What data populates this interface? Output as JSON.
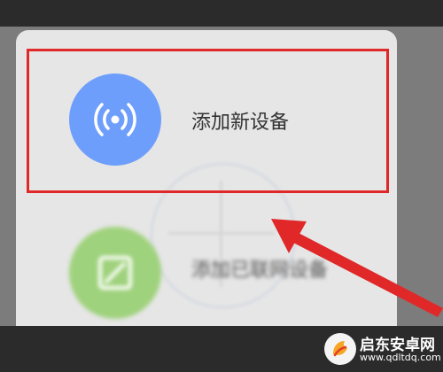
{
  "menu": {
    "items": [
      {
        "label": "添加新设备",
        "icon": "signal-broadcast-icon",
        "color": "#6e9efb"
      },
      {
        "label": "添加已联网设备",
        "icon": "edit-square-icon",
        "color": "#9fd27c"
      }
    ]
  },
  "annotation": {
    "highlight_color": "#e02828",
    "arrow_color": "#e02828"
  },
  "watermark": {
    "name": "启东安卓网",
    "url": "www.qdltdq.com"
  }
}
